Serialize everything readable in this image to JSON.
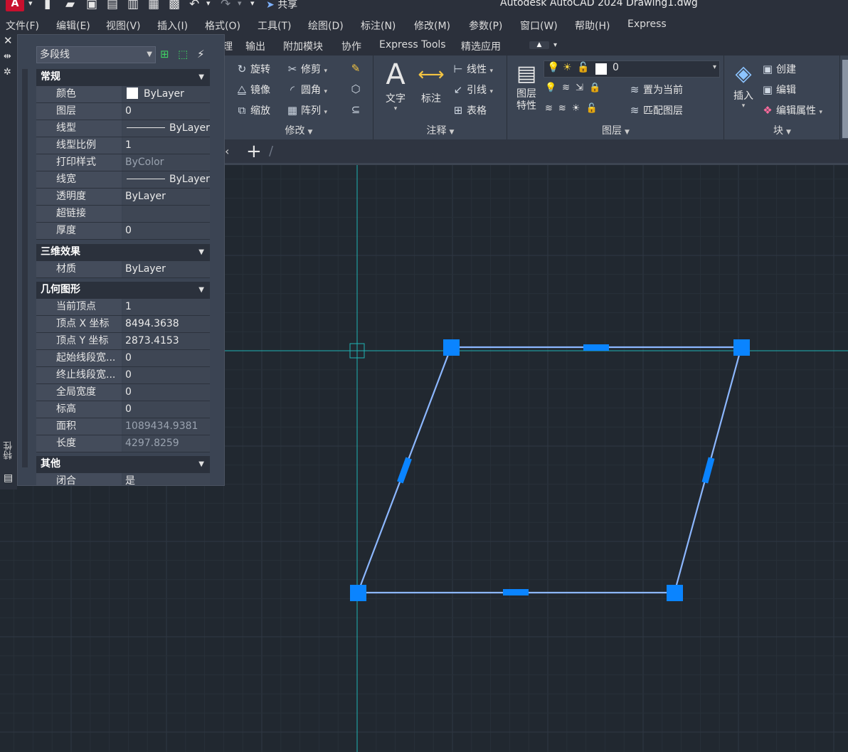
{
  "titlebar": {
    "app_logo": "A",
    "share_label": "共享",
    "title": "Autodesk AutoCAD 2024    Drawing1.dwg"
  },
  "menubar": {
    "items": [
      "文件(F)",
      "编辑(E)",
      "视图(V)",
      "插入(I)",
      "格式(O)",
      "工具(T)",
      "绘图(D)",
      "标注(N)",
      "修改(M)",
      "参数(P)",
      "窗口(W)",
      "帮助(H)",
      "Express"
    ]
  },
  "ribbon_tabs": {
    "items": [
      "输出",
      "附加模块",
      "协作",
      "Express Tools",
      "精选应用"
    ],
    "partial_prefix": "理"
  },
  "ribbon": {
    "modify": {
      "title": "修改",
      "buttons": [
        "旋转",
        "修剪",
        "镜像",
        "圆角",
        "缩放",
        "阵列"
      ]
    },
    "annotation": {
      "title": "注释",
      "big_text": "文字",
      "big_dim": "标注",
      "buttons": [
        "线性",
        "引线",
        "表格"
      ]
    },
    "layers": {
      "title": "图层",
      "big_props_line1": "图层",
      "big_props_line2": "特性",
      "current_layer": "0",
      "buttons": [
        "置为当前",
        "匹配图层"
      ]
    },
    "block": {
      "title": "块",
      "big_insert": "插入",
      "buttons": [
        "创建",
        "编辑",
        "编辑属性"
      ]
    }
  },
  "properties": {
    "object_type": "多段线",
    "sections": {
      "general": {
        "title": "常规",
        "rows": [
          {
            "key": "颜色",
            "value": "ByLayer"
          },
          {
            "key": "图层",
            "value": "0"
          },
          {
            "key": "线型",
            "value": "ByLayer"
          },
          {
            "key": "线型比例",
            "value": "1"
          },
          {
            "key": "打印样式",
            "value": "ByColor"
          },
          {
            "key": "线宽",
            "value": "ByLayer"
          },
          {
            "key": "透明度",
            "value": "ByLayer"
          },
          {
            "key": "超链接",
            "value": ""
          },
          {
            "key": "厚度",
            "value": "0"
          }
        ]
      },
      "threed": {
        "title": "三维效果",
        "rows": [
          {
            "key": "材质",
            "value": "ByLayer"
          }
        ]
      },
      "geometry": {
        "title": "几何图形",
        "rows": [
          {
            "key": "当前顶点",
            "value": "1"
          },
          {
            "key": "顶点 X 坐标",
            "value": "8494.3638"
          },
          {
            "key": "顶点 Y 坐标",
            "value": "2873.4153"
          },
          {
            "key": "起始线段宽...",
            "value": "0"
          },
          {
            "key": "终止线段宽...",
            "value": "0"
          },
          {
            "key": "全局宽度",
            "value": "0"
          },
          {
            "key": "标高",
            "value": "0"
          },
          {
            "key": "面积",
            "value": "1089434.9381"
          },
          {
            "key": "长度",
            "value": "4297.8259"
          }
        ]
      },
      "misc": {
        "title": "其他",
        "rows": [
          {
            "key": "闭合",
            "value": "是"
          }
        ]
      }
    }
  },
  "left_strip": {
    "vertical_label": "特性"
  },
  "colors": {
    "canvas_bg": "#212830",
    "grid_minor": "#283039",
    "grid_major": "#2f3843",
    "crosshair": "#1fb3b3",
    "polyline": "#8cb7ff",
    "grip": "#0a84ff"
  },
  "icons": {
    "close": "close-icon",
    "pin": "pin-icon",
    "settings": "gear-icon",
    "add_tab": "plus-icon"
  }
}
